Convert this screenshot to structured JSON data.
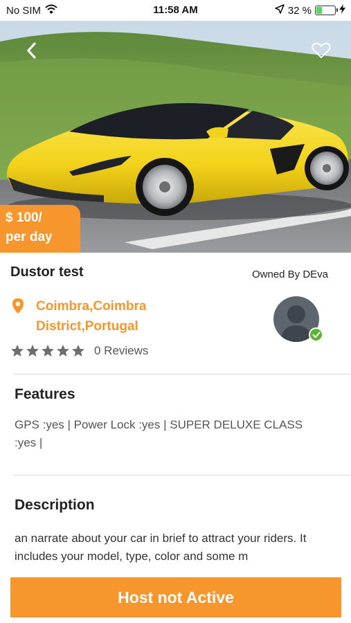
{
  "status_bar": {
    "carrier": "No SIM",
    "time": "11:58 AM",
    "battery_percent": "32 %",
    "battery_level": 0.32,
    "wifi_icon": "wifi-icon",
    "location_icon": "location-arrow-icon",
    "charging_icon": "charging-bolt-icon"
  },
  "hero": {
    "back_icon": "chevron-left-icon",
    "favorite_icon": "heart-outline-icon",
    "price_label": "$ 100/",
    "price_unit": "per day"
  },
  "car": {
    "title": "Dustor test",
    "owner_label": "Owned By DEva",
    "location_icon": "map-pin-icon",
    "location": "Coimbra,Coimbra District,Portugal",
    "rating": 5,
    "reviews_label": "0 Reviews"
  },
  "features": {
    "heading": "Features",
    "text": "GPS :yes  |  Power Lock :yes  |  SUPER DELUXE CLASS :yes  |"
  },
  "description": {
    "heading": "Description",
    "text": "an narrate about your car in brief to attract your riders. It includes your model, type, color and some m"
  },
  "action": {
    "button_label": "Host not Active"
  },
  "colors": {
    "accent": "#f7962c",
    "car_yellow": "#f2d21a",
    "verified": "#5cb531"
  }
}
